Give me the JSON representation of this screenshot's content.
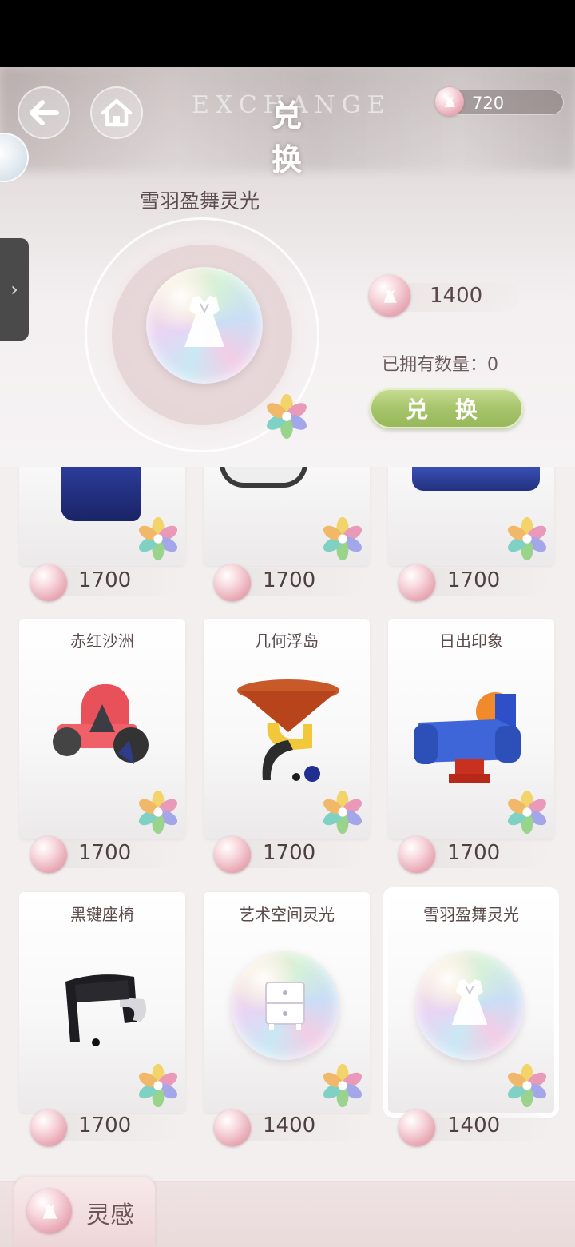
{
  "header": {
    "title": "兑 换",
    "bg_word": "EXCHANGE",
    "currency_value": "720"
  },
  "featured": {
    "name": "雪羽盈舞灵光",
    "price": "1400",
    "owned": "已拥有数量：0",
    "exchange_label": "兑 换"
  },
  "items": [
    {
      "name": "",
      "price": "1700"
    },
    {
      "name": "",
      "price": "1700"
    },
    {
      "name": "",
      "price": "1700"
    },
    {
      "name": "赤红沙洲",
      "price": "1700"
    },
    {
      "name": "几何浮岛",
      "price": "1700"
    },
    {
      "name": "日出印象",
      "price": "1700"
    },
    {
      "name": "黑键座椅",
      "price": "1700"
    },
    {
      "name": "艺术空间灵光",
      "price": "1400"
    },
    {
      "name": "雪羽盈舞灵光",
      "price": "1400"
    }
  ],
  "bottom_tab": {
    "label": "灵感"
  },
  "colors": {
    "accent_green": "#a6c46a",
    "coin_pink": "#e8a9b5"
  }
}
